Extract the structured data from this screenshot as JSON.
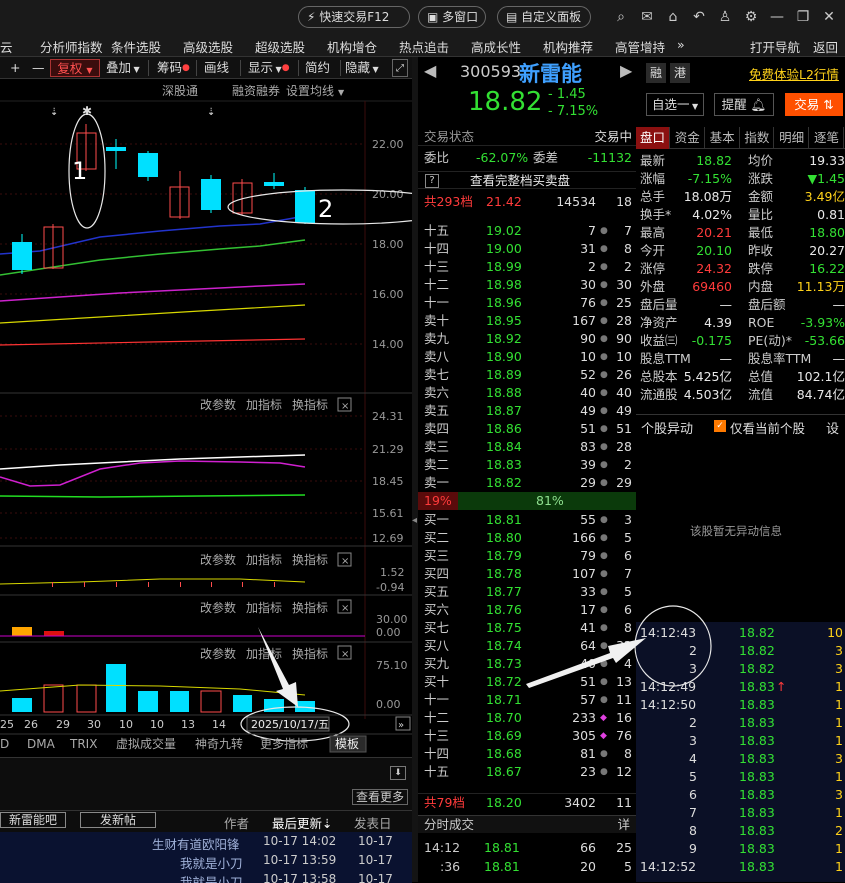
{
  "titlebar": {
    "quick_trade": "快速交易F12",
    "multi_window": "多窗口",
    "custom_panel": "自定义面板"
  },
  "menu": [
    "云",
    "分析师指数",
    "条件选股",
    "高级选股",
    "超级选股",
    "机构增仓",
    "热点追击",
    "高成长性",
    "机构推荐",
    "高管增持",
    "»",
    "打开导航",
    "返回"
  ],
  "toolbar": {
    "plus": "+",
    "minus": "—",
    "restore": "复权",
    "overlay": "叠加",
    "chips": "筹码",
    "draw": "画线",
    "display": "显示",
    "simple": "简约",
    "hide": "隐藏"
  },
  "chart_tabs": [
    "深股通",
    "融资融券",
    "设置均线"
  ],
  "price_axis": [
    "22.00",
    "20.00",
    "18.00",
    "16.00",
    "14.00"
  ],
  "annotations": {
    "a1": "1",
    "a2": "2",
    "date_label": "2025/10/17/五"
  },
  "indicator_controls": {
    "change": "改参数",
    "add": "加指标",
    "swap": "换指标"
  },
  "ind1_axis": [
    "24.31",
    "21.29",
    "18.45",
    "15.61",
    "12.69"
  ],
  "ind2_axis": [
    "1.52",
    "-0.94"
  ],
  "ind3_axis": [
    "30.00",
    "0.00"
  ],
  "ind4_axis": [
    "75.10",
    "0.00"
  ],
  "x_dates": [
    "25",
    "26",
    "29",
    "30",
    "10",
    "10",
    "13",
    "14"
  ],
  "bottom_tabs": [
    "D",
    "DMA",
    "TRIX",
    "虚拟成交量",
    "神奇九转",
    "更多指标",
    "模板"
  ],
  "forum": {
    "view_more": "查看更多",
    "bar_name": "新雷能吧",
    "post": "发新帖",
    "author": "作者",
    "latest": "最后更新",
    "posted": "发表日",
    "rows": [
      {
        "title": "生财有道欧阳锋",
        "time": "10-17 14:02",
        "date": "10-17"
      },
      {
        "title": "我就是小刀",
        "time": "10-17 13:59",
        "date": "10-17"
      },
      {
        "title": "我就是小刀",
        "time": "10-17 13:58",
        "date": "10-17"
      }
    ]
  },
  "stock": {
    "code": "300593",
    "name": "新雷能",
    "tag1": "融",
    "tag2": "港",
    "l2": "免费体验L2行情",
    "price": "18.82",
    "change": "- 1.45",
    "pct": "- 7.15%",
    "watch": "自选一",
    "alert": "提醒",
    "trade": "交易"
  },
  "book": {
    "status": "交易状态",
    "status_val": "交易中",
    "weibi_l": "委比",
    "weibi": "-62.07%",
    "weicha_l": "委差",
    "weicha": "-11132",
    "full": "查看完整档买卖盘",
    "q": "?",
    "total_sell": {
      "label": "共293档",
      "price": "21.42",
      "vol": "14534",
      "cnt": "18"
    },
    "asks": [
      {
        "l": "十五",
        "p": "19.02",
        "v": "7",
        "c": "7"
      },
      {
        "l": "十四",
        "p": "19.00",
        "v": "31",
        "c": "8"
      },
      {
        "l": "十三",
        "p": "18.99",
        "v": "2",
        "c": "2"
      },
      {
        "l": "十二",
        "p": "18.98",
        "v": "30",
        "c": "30"
      },
      {
        "l": "十一",
        "p": "18.96",
        "v": "76",
        "c": "25"
      },
      {
        "l": "卖十",
        "p": "18.95",
        "v": "167",
        "c": "28"
      },
      {
        "l": "卖九",
        "p": "18.92",
        "v": "90",
        "c": "90"
      },
      {
        "l": "卖八",
        "p": "18.90",
        "v": "10",
        "c": "10"
      },
      {
        "l": "卖七",
        "p": "18.89",
        "v": "52",
        "c": "26"
      },
      {
        "l": "卖六",
        "p": "18.88",
        "v": "40",
        "c": "40"
      },
      {
        "l": "卖五",
        "p": "18.87",
        "v": "49",
        "c": "49"
      },
      {
        "l": "卖四",
        "p": "18.86",
        "v": "51",
        "c": "51"
      },
      {
        "l": "卖三",
        "p": "18.84",
        "v": "83",
        "c": "28"
      },
      {
        "l": "卖二",
        "p": "18.83",
        "v": "39",
        "c": "2"
      },
      {
        "l": "卖一",
        "p": "18.82",
        "v": "29",
        "c": "29"
      }
    ],
    "ratio_buy": "19%",
    "ratio_sell": "81%",
    "bids": [
      {
        "l": "买一",
        "p": "18.81",
        "v": "55",
        "c": "3"
      },
      {
        "l": "买二",
        "p": "18.80",
        "v": "166",
        "c": "5"
      },
      {
        "l": "买三",
        "p": "18.79",
        "v": "79",
        "c": "6"
      },
      {
        "l": "买四",
        "p": "18.78",
        "v": "107",
        "c": "7"
      },
      {
        "l": "买五",
        "p": "18.77",
        "v": "33",
        "c": "5"
      },
      {
        "l": "买六",
        "p": "18.76",
        "v": "17",
        "c": "6"
      },
      {
        "l": "买七",
        "p": "18.75",
        "v": "41",
        "c": "8"
      },
      {
        "l": "买八",
        "p": "18.74",
        "v": "64",
        "c": "32"
      },
      {
        "l": "买九",
        "p": "18.73",
        "v": "40",
        "c": "4"
      },
      {
        "l": "买十",
        "p": "18.72",
        "v": "51",
        "c": "13"
      },
      {
        "l": "十一",
        "p": "18.71",
        "v": "57",
        "c": "11"
      },
      {
        "l": "十二",
        "p": "18.70",
        "v": "233",
        "c": "16"
      },
      {
        "l": "十三",
        "p": "18.69",
        "v": "305",
        "c": "76"
      },
      {
        "l": "十四",
        "p": "18.68",
        "v": "81",
        "c": "8"
      },
      {
        "l": "十五",
        "p": "18.67",
        "v": "23",
        "c": "12"
      }
    ],
    "total_buy": {
      "label": "共79档",
      "price": "18.20",
      "vol": "3402",
      "cnt": "11"
    },
    "time_trades": "分时成交",
    "detail": "详",
    "trades": [
      {
        "t": "14:12",
        "p": "18.81",
        "v": "66",
        "c": "25"
      },
      {
        "t": ":36",
        "p": "18.81",
        "v": "20",
        "c": "5"
      }
    ]
  },
  "stats": {
    "tabs": [
      "盘口",
      "资金",
      "基本",
      "指数",
      "明细",
      "逐笔"
    ],
    "rows": [
      [
        "最新",
        "18.82",
        "均价",
        "19.33"
      ],
      [
        "涨幅",
        "-7.15%",
        "涨跌",
        "▼1.45"
      ],
      [
        "总手",
        "18.08万",
        "金额",
        "3.49亿"
      ],
      [
        "换手*",
        "4.02%",
        "量比",
        "0.81"
      ],
      [
        "最高",
        "20.21",
        "最低",
        "18.80"
      ],
      [
        "今开",
        "20.10",
        "昨收",
        "20.27"
      ],
      [
        "涨停",
        "24.32",
        "跌停",
        "16.22"
      ],
      [
        "外盘",
        "69460",
        "内盘",
        "11.13万"
      ],
      [
        "盘后量",
        "—",
        "盘后额",
        "—"
      ],
      [
        "净资产",
        "4.39",
        "ROE",
        "-3.93%"
      ],
      [
        "收益㈢",
        "-0.175",
        "PE(动)*",
        "-53.66"
      ],
      [
        "股息TTM",
        "—",
        "股息率TTM",
        "—"
      ],
      [
        "总股本",
        "5.425亿",
        "总值",
        "102.1亿"
      ],
      [
        "流通股",
        "4.503亿",
        "流值",
        "84.74亿"
      ]
    ]
  },
  "anomaly": {
    "title": "个股异动",
    "only_current": "仅看当前个股",
    "settings": "设",
    "empty": "该股暂无异动信息"
  },
  "ticks": [
    {
      "t": "14:12:43",
      "p": "18.82",
      "v": "10"
    },
    {
      "t": "2",
      "p": "18.82",
      "v": "3"
    },
    {
      "t": "3",
      "p": "18.82",
      "v": "3"
    },
    {
      "t": "14:12:49",
      "p": "18.83",
      "v": "1",
      "up": "↑"
    },
    {
      "t": "14:12:50",
      "p": "18.83",
      "v": "1"
    },
    {
      "t": "2",
      "p": "18.83",
      "v": "1"
    },
    {
      "t": "3",
      "p": "18.83",
      "v": "1"
    },
    {
      "t": "4",
      "p": "18.83",
      "v": "3"
    },
    {
      "t": "5",
      "p": "18.83",
      "v": "1"
    },
    {
      "t": "6",
      "p": "18.83",
      "v": "3"
    },
    {
      "t": "7",
      "p": "18.83",
      "v": "1"
    },
    {
      "t": "8",
      "p": "18.83",
      "v": "2"
    },
    {
      "t": "9",
      "p": "18.83",
      "v": "1"
    },
    {
      "t": "14:12:52",
      "p": "18.83",
      "v": "1"
    }
  ]
}
